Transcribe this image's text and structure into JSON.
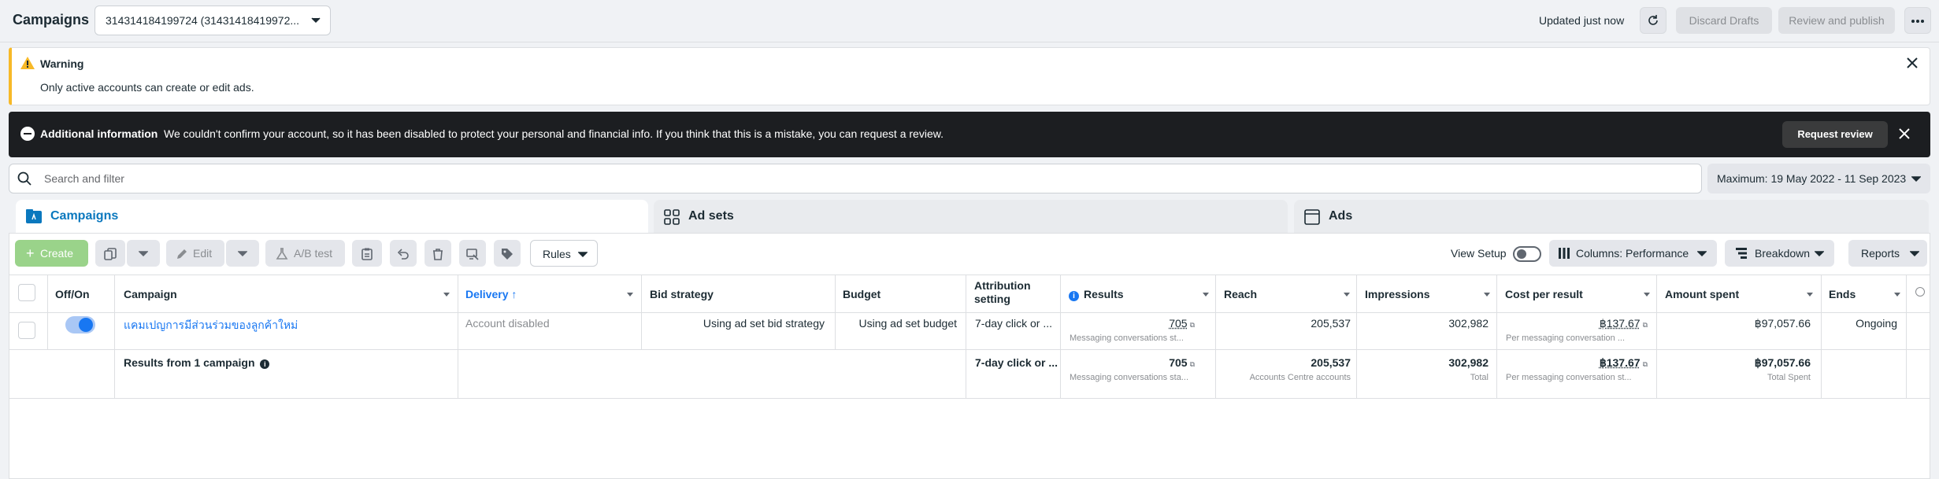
{
  "header": {
    "title": "Campaigns",
    "account_selector": "314314184199724 (31431418419972...",
    "updated": "Updated just now",
    "discard_drafts": "Discard Drafts",
    "review_publish": "Review and publish"
  },
  "warning": {
    "title": "Warning",
    "text": "Only active accounts can create or edit ads."
  },
  "info_banner": {
    "title": "Additional information",
    "text": "We couldn't confirm your account, so it has been disabled to protect your personal and financial info. If you think that this is a mistake, you can request a review.",
    "button": "Request review"
  },
  "search": {
    "placeholder": "Search and filter",
    "date_range": "Maximum: 19 May 2022 - 11 Sep 2023"
  },
  "tabs": [
    {
      "label": "Campaigns",
      "active": true
    },
    {
      "label": "Ad sets",
      "active": false
    },
    {
      "label": "Ads",
      "active": false
    }
  ],
  "toolbar": {
    "create": "Create",
    "edit": "Edit",
    "ab_test": "A/B test",
    "rules": "Rules",
    "view_setup": "View Setup",
    "columns": "Columns: Performance",
    "breakdown": "Breakdown",
    "reports": "Reports"
  },
  "table": {
    "columns": {
      "offon": "Off/On",
      "campaign": "Campaign",
      "delivery": "Delivery",
      "bid_strategy": "Bid strategy",
      "budget": "Budget",
      "attribution": "Attribution setting",
      "results": "Results",
      "reach": "Reach",
      "impressions": "Impressions",
      "cost_per_result": "Cost per result",
      "amount_spent": "Amount spent",
      "ends": "Ends"
    },
    "row": {
      "campaign": "แคมเปญการมีส่วนร่วมของลูกค้าใหม่",
      "delivery": "Account disabled",
      "bid_strategy": "Using ad set bid strategy",
      "budget": "Using ad set budget",
      "attribution": "7-day click or ...",
      "results": "705",
      "results_sub": "Messaging conversations st...",
      "reach": "205,537",
      "impressions": "302,982",
      "cost_per_result": "฿137.67",
      "cost_sub": "Per messaging conversation ...",
      "amount_spent": "฿97,057.66",
      "ends": "Ongoing"
    },
    "summary": {
      "label": "Results from 1 campaign",
      "attribution": "7-day click or ...",
      "results": "705",
      "results_sub": "Messaging conversations sta...",
      "reach": "205,537",
      "reach_sub": "Accounts Centre accounts",
      "impressions": "302,982",
      "impressions_sub": "Total",
      "cost_per_result": "฿137.67",
      "cost_sub": "Per messaging conversation st...",
      "amount_spent": "฿97,057.66",
      "amount_sub": "Total Spent"
    }
  },
  "colors": {
    "accent": "#0a78be",
    "link": "#1877f2",
    "warning": "#f7b928",
    "banner": "#1c1e21"
  }
}
